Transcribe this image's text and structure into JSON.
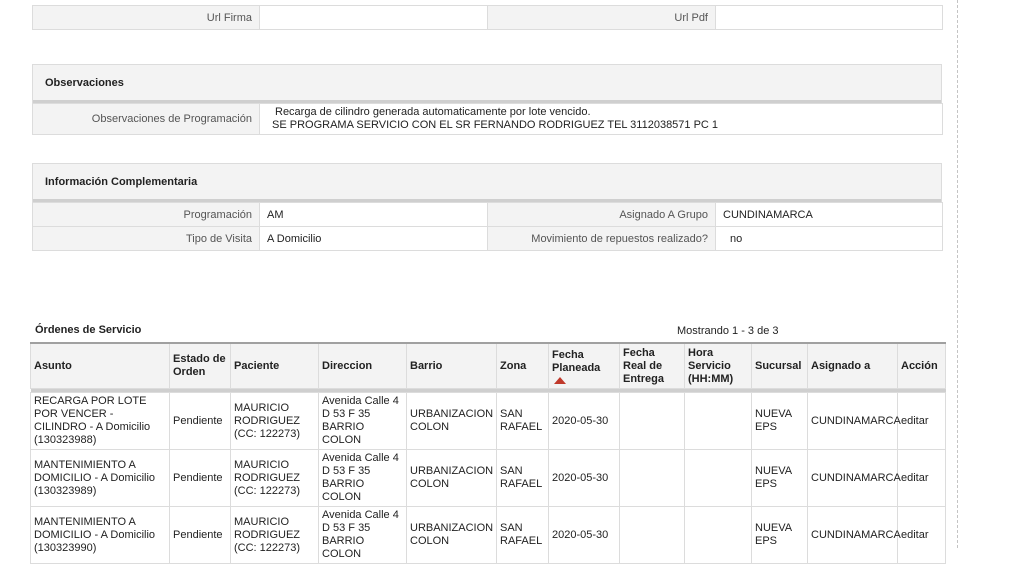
{
  "url_row": {
    "url_firma_label": "Url Firma",
    "url_firma_value": "",
    "url_pdf_label": "Url Pdf",
    "url_pdf_value": ""
  },
  "observaciones": {
    "title": "Observaciones",
    "label": "Observaciones de Programación",
    "line1": "Recarga de cilindro generada automaticamente por lote vencido.",
    "line2": "SE PROGRAMA SERVICIO CON EL SR FERNANDO RODRIGUEZ TEL 3112038571 PC 1"
  },
  "info": {
    "title": "Información Complementaria",
    "programacion_label": "Programación",
    "programacion_value": "AM",
    "grupo_label": "Asignado A Grupo",
    "grupo_value": "CUNDINAMARCA",
    "tipo_label": "Tipo de Visita",
    "tipo_value": "A Domicilio",
    "repuestos_label": "Movimiento de repuestos realizado?",
    "repuestos_value": "no"
  },
  "orders": {
    "title": "Órdenes de Servicio",
    "count_text": "Mostrando 1 - 3 de 3",
    "columns": {
      "asunto": "Asunto",
      "estado": "Estado de Orden",
      "paciente": "Paciente",
      "direccion": "Direccion",
      "barrio": "Barrio",
      "zona": "Zona",
      "fecha_planeada": "Fecha Planeada",
      "fecha_real": "Fecha Real de Entrega",
      "hora": "Hora Servicio (HH:MM)",
      "sucursal": "Sucursal",
      "asignado": "Asignado a",
      "accion": "Acción"
    },
    "rows": [
      {
        "asunto": "RECARGA POR LOTE POR VENCER - CILINDRO - A Domicilio (130323988)",
        "estado": "Pendiente",
        "paciente": "MAURICIO RODRIGUEZ (CC: 122273)",
        "direccion": "Avenida Calle 4 D 53 F 35 BARRIO COLON",
        "barrio": "URBANIZACION COLON",
        "zona": "SAN RAFAEL",
        "fecha_planeada": "2020-05-30",
        "fecha_real": "",
        "hora": "",
        "sucursal": "NUEVA EPS",
        "asignado": "CUNDINAMARCA",
        "accion": "editar"
      },
      {
        "asunto": "MANTENIMIENTO A DOMICILIO - A Domicilio (130323989)",
        "estado": "Pendiente",
        "paciente": "MAURICIO RODRIGUEZ (CC: 122273)",
        "direccion": "Avenida Calle 4 D 53 F 35 BARRIO COLON",
        "barrio": "URBANIZACION COLON",
        "zona": "SAN RAFAEL",
        "fecha_planeada": "2020-05-30",
        "fecha_real": "",
        "hora": "",
        "sucursal": "NUEVA EPS",
        "asignado": "CUNDINAMARCA",
        "accion": "editar"
      },
      {
        "asunto": "MANTENIMIENTO A DOMICILIO - A Domicilio (130323990)",
        "estado": "Pendiente",
        "paciente": "MAURICIO RODRIGUEZ (CC: 122273)",
        "direccion": "Avenida Calle 4 D 53 F 35 BARRIO COLON",
        "barrio": "URBANIZACION COLON",
        "zona": "SAN RAFAEL",
        "fecha_planeada": "2020-05-30",
        "fecha_real": "",
        "hora": "",
        "sucursal": "NUEVA EPS",
        "asignado": "CUNDINAMARCA",
        "accion": "editar"
      }
    ]
  }
}
